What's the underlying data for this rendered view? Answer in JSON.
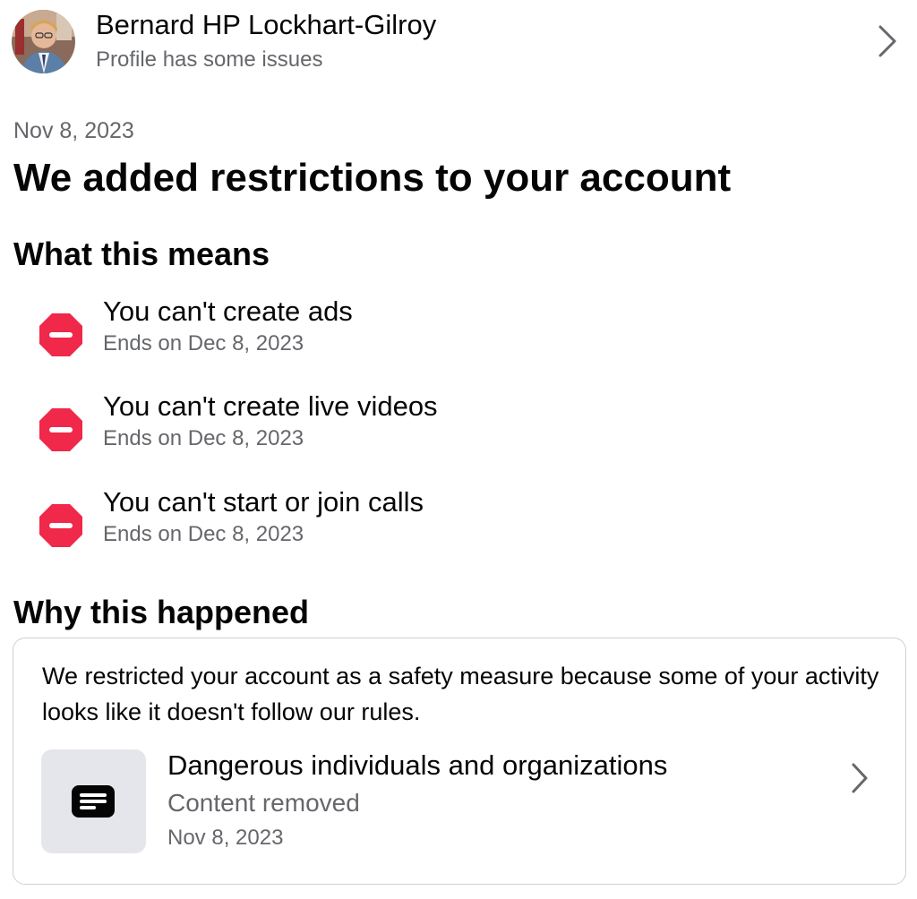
{
  "profile": {
    "name": "Bernard HP Lockhart-Gilroy",
    "status": "Profile has some issues",
    "avatar_icon": "profile-photo",
    "chevron_icon": "chevron-right-icon"
  },
  "notice": {
    "date": "Nov 8, 2023",
    "title": "We added restrictions to your account"
  },
  "what_this_means": {
    "heading": "What this means",
    "restriction_icon": "no-entry-icon",
    "restriction_color": "#f02849",
    "items": [
      {
        "title": "You can't create ads",
        "ends": "Ends on Dec 8, 2023"
      },
      {
        "title": "You can't create live videos",
        "ends": "Ends on Dec 8, 2023"
      },
      {
        "title": "You can't start or join calls",
        "ends": "Ends on Dec 8, 2023"
      }
    ]
  },
  "why_this_happened": {
    "heading": "Why this happened",
    "explanation": "We restricted your account as a safety measure because some of your activity looks like it doesn't follow our rules.",
    "violation": {
      "title": "Dangerous individuals and organizations",
      "status": "Content removed",
      "date": "Nov 8, 2023",
      "icon": "post-content-icon"
    }
  },
  "colors": {
    "primary_text": "#050505",
    "secondary_text": "#65676b",
    "border": "#ced0d4",
    "thumb_bg": "#e4e6eb",
    "alert_red": "#f02849"
  }
}
